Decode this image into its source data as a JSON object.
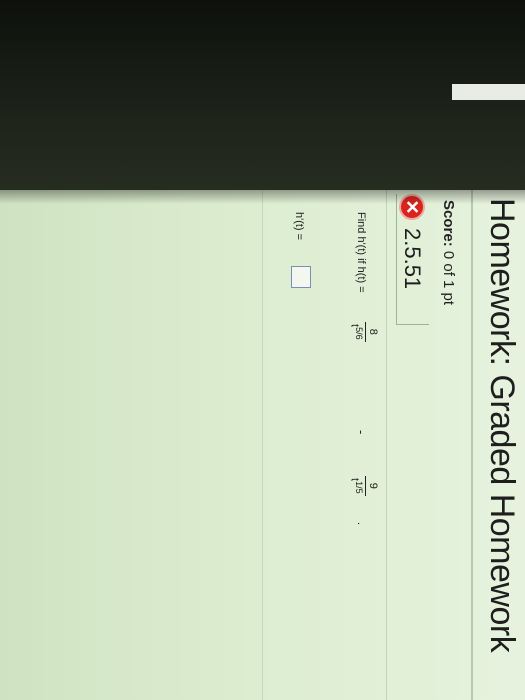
{
  "homework": {
    "title": "Homework: Graded Homework",
    "score_label": "Score:",
    "score_value": "0 of 1 pt"
  },
  "question": {
    "status_icon": "x-icon",
    "number": "2.5.51",
    "prompt": "Find h'(t) if h(t) =",
    "term1": {
      "numerator": "8",
      "denominator_base": "t",
      "denominator_exp": "5/6"
    },
    "operator": "-",
    "term2": {
      "numerator": "9",
      "denominator_base": "t",
      "denominator_exp": "1/5"
    },
    "end_punct": ".",
    "answer_label": "h'(t) =",
    "answer_value": ""
  },
  "colors": {
    "screen": "#dcedcf",
    "error_icon": "#d9241e",
    "input_border": "#7a8fb8"
  }
}
